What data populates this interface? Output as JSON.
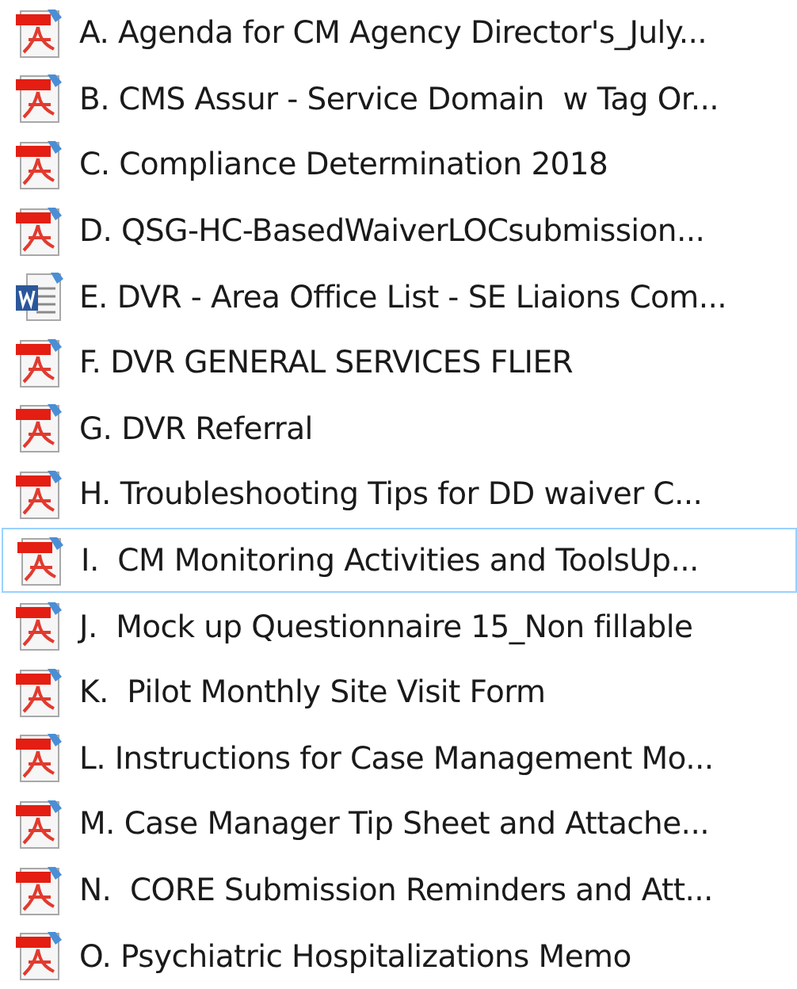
{
  "files": [
    {
      "name": "A. Agenda for CM Agency Director's_July...",
      "kind": "pdf",
      "focused": false
    },
    {
      "name": "B. CMS Assur - Service Domain  w Tag Or...",
      "kind": "pdf",
      "focused": false
    },
    {
      "name": "C. Compliance Determination 2018",
      "kind": "pdf",
      "focused": false
    },
    {
      "name": "D. QSG-HC-BasedWaiverLOCsubmission...",
      "kind": "pdf",
      "focused": false
    },
    {
      "name": "E. DVR - Area Office List - SE Liaions Com...",
      "kind": "word",
      "focused": false
    },
    {
      "name": "F. DVR GENERAL SERVICES FLIER",
      "kind": "pdf",
      "focused": false
    },
    {
      "name": "G. DVR Referral",
      "kind": "pdf",
      "focused": false
    },
    {
      "name": "H. Troubleshooting Tips for DD waiver C...",
      "kind": "pdf",
      "focused": false
    },
    {
      "name": "I.  CM Monitoring Activities and ToolsUp...",
      "kind": "pdf",
      "focused": true
    },
    {
      "name": "J.  Mock up Questionnaire 15_Non fillable",
      "kind": "pdf",
      "focused": false
    },
    {
      "name": "K.  Pilot Monthly Site Visit Form",
      "kind": "pdf",
      "focused": false
    },
    {
      "name": "L. Instructions for Case Management Mo...",
      "kind": "pdf",
      "focused": false
    },
    {
      "name": "M. Case Manager Tip Sheet and Attache...",
      "kind": "pdf",
      "focused": false
    },
    {
      "name": "N.  CORE Submission Reminders and Att...",
      "kind": "pdf",
      "focused": false
    },
    {
      "name": "O. Psychiatric Hospitalizations Memo",
      "kind": "pdf",
      "focused": false
    }
  ]
}
